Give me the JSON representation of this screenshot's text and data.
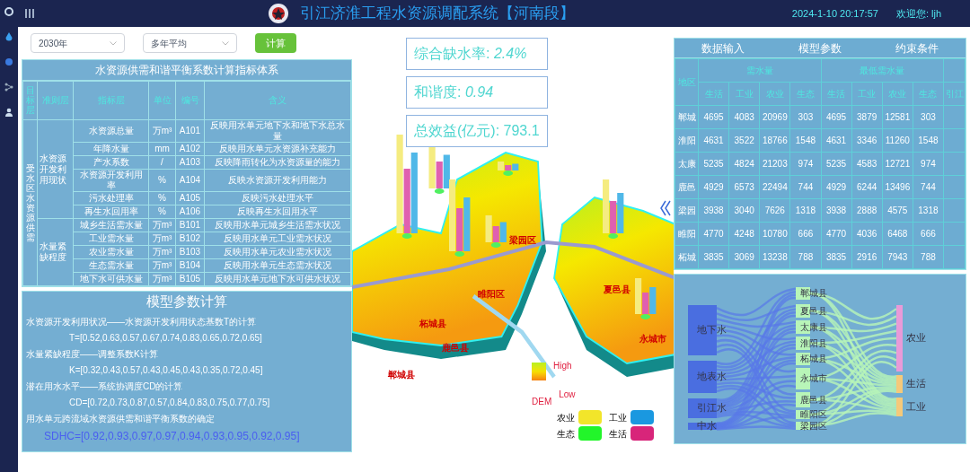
{
  "header": {
    "title": "引江济淮工程水资源调配系统【河南段】",
    "datetime": "2024-1-10 20:17:57",
    "welcome": "欢迎您: ljh"
  },
  "controls": {
    "year": "2030年",
    "period": "多年平均",
    "button": "计算"
  },
  "indicator_table": {
    "title": "水资源供需和谐平衡系数计算指标体系",
    "columns": [
      "目标层",
      "准则层",
      "指标层",
      "单位",
      "编号",
      "含义"
    ],
    "target": "受水区水资源供需",
    "groups": [
      {
        "criterion": "水资源开发利用现状",
        "rows": [
          {
            "indicator": "水资源总量",
            "unit": "万m³",
            "code": "A101",
            "meaning": "反映用水单元地下水和地下水总水量"
          },
          {
            "indicator": "年降水量",
            "unit": "mm",
            "code": "A102",
            "meaning": "反映用水单元水资源补充能力"
          },
          {
            "indicator": "产水系数",
            "unit": "/",
            "code": "A103",
            "meaning": "反映降雨转化为水资源量的能力"
          },
          {
            "indicator": "水资源开发利用率",
            "unit": "%",
            "code": "A104",
            "meaning": "反映水资源开发利用能力"
          },
          {
            "indicator": "污水处理率",
            "unit": "%",
            "code": "A105",
            "meaning": "反映污水处理水平"
          },
          {
            "indicator": "再生水回用率",
            "unit": "%",
            "code": "A106",
            "meaning": "反映再生水回用水平"
          }
        ]
      },
      {
        "criterion": "水量紧缺程度",
        "rows": [
          {
            "indicator": "城乡生活需水量",
            "unit": "万m³",
            "code": "B101",
            "meaning": "反映用水单元城乡生活需水状况"
          },
          {
            "indicator": "工业需水量",
            "unit": "万m³",
            "code": "B102",
            "meaning": "反映用水单元工业需水状况"
          },
          {
            "indicator": "农业需水量",
            "unit": "万m³",
            "code": "B103",
            "meaning": "反映用水单元农业需水状况"
          },
          {
            "indicator": "生态需水量",
            "unit": "万m³",
            "code": "B104",
            "meaning": "反映用水单元生态需水状况"
          },
          {
            "indicator": "地下水可供水量",
            "unit": "万m³",
            "code": "B105",
            "meaning": "反映用水单元地下水可供水状况"
          }
        ]
      }
    ]
  },
  "model_params": {
    "title": "模型参数计算",
    "lines": [
      {
        "kind": "heading",
        "text": "水资源开发利用状况——水资源开发利用状态基数T的计算"
      },
      {
        "kind": "formula",
        "text": "T=[0.52,0.63,0.57,0.67,0.74,0.83,0.65,0.72,0.65]"
      },
      {
        "kind": "heading",
        "text": "水量紧缺程度——调整系数K计算"
      },
      {
        "kind": "formula",
        "text": "K=[0.32,0.43,0.57,0.43,0.45,0.43,0.35,0.72,0.45]"
      },
      {
        "kind": "heading",
        "text": "潜在用水水平——系统协调度CD的计算"
      },
      {
        "kind": "formula",
        "text": "CD=[0.72,0.73,0.87,0.57,0.84,0.83,0.75,0.77,0.75]"
      },
      {
        "kind": "heading",
        "text": "用水单元跨流域水资源供需和谐平衡系数的确定"
      },
      {
        "kind": "result",
        "text": "SDHC=[0.92,0.93,0.97,0.97,0.94,0.93,0.95,0.92,0.95]"
      }
    ]
  },
  "stats": [
    {
      "label": "综合缺水率: ",
      "value": "2.4%",
      "italic": true
    },
    {
      "label": "和谐度: ",
      "value": "0.94",
      "italic": true
    },
    {
      "label": "总效益(亿元): ",
      "value": "793.1",
      "italic": false
    }
  ],
  "map": {
    "labels": [
      "梁园区",
      "睢阳区",
      "柘城县",
      "鹿邑县",
      "郸城县",
      "夏邑县",
      "永城市"
    ],
    "dem_title": "DEM",
    "high": "High",
    "low": "Low",
    "legend": [
      {
        "label": "农业",
        "color": "#f2e52a"
      },
      {
        "label": "工业",
        "color": "#1a98e0"
      },
      {
        "label": "生态",
        "color": "#22f52a"
      },
      {
        "label": "生活",
        "color": "#d8257a"
      }
    ]
  },
  "data_panel": {
    "tabs": [
      "数据输入",
      "模型参数",
      "约束条件"
    ],
    "region_header": "地区",
    "groups": [
      {
        "title": "需水量",
        "columns": [
          "生活",
          "工业",
          "农业",
          "生态"
        ]
      },
      {
        "title": "最低需水量",
        "columns": [
          "生活",
          "工业",
          "农业",
          "生态"
        ]
      }
    ],
    "extra_column": "引江",
    "rows": [
      {
        "region": "郸城",
        "values": [
          "4695",
          "4083",
          "20969",
          "303",
          "4695",
          "3879",
          "12581",
          "303"
        ]
      },
      {
        "region": "淮阳",
        "values": [
          "4631",
          "3522",
          "18766",
          "1548",
          "4631",
          "3346",
          "11260",
          "1548"
        ]
      },
      {
        "region": "太康",
        "values": [
          "5235",
          "4824",
          "21203",
          "974",
          "5235",
          "4583",
          "12721",
          "974"
        ]
      },
      {
        "region": "鹿邑",
        "values": [
          "4929",
          "6573",
          "22494",
          "744",
          "4929",
          "6244",
          "13496",
          "744"
        ]
      },
      {
        "region": "梁园",
        "values": [
          "3938",
          "3040",
          "7626",
          "1318",
          "3938",
          "2888",
          "4575",
          "1318"
        ]
      },
      {
        "region": "睢阳",
        "values": [
          "4770",
          "4248",
          "10780",
          "666",
          "4770",
          "4036",
          "6468",
          "666"
        ]
      },
      {
        "region": "柘城",
        "values": [
          "3835",
          "3069",
          "13238",
          "788",
          "3835",
          "2916",
          "7943",
          "788"
        ]
      }
    ]
  },
  "sankey": {
    "sources": [
      "地下水",
      "地表水",
      "引江水",
      "中水"
    ],
    "counties": [
      "郸城县",
      "夏邑县",
      "太康县",
      "淮阳县",
      "柘城县",
      "永城市",
      "鹿邑县",
      "睢阳区",
      "梁园区"
    ],
    "uses": [
      {
        "label": "农业",
        "color": "#e99ad8"
      },
      {
        "label": "生活",
        "color": "#f5c97a"
      },
      {
        "label": "工业",
        "color": "#f5c97a"
      }
    ]
  }
}
